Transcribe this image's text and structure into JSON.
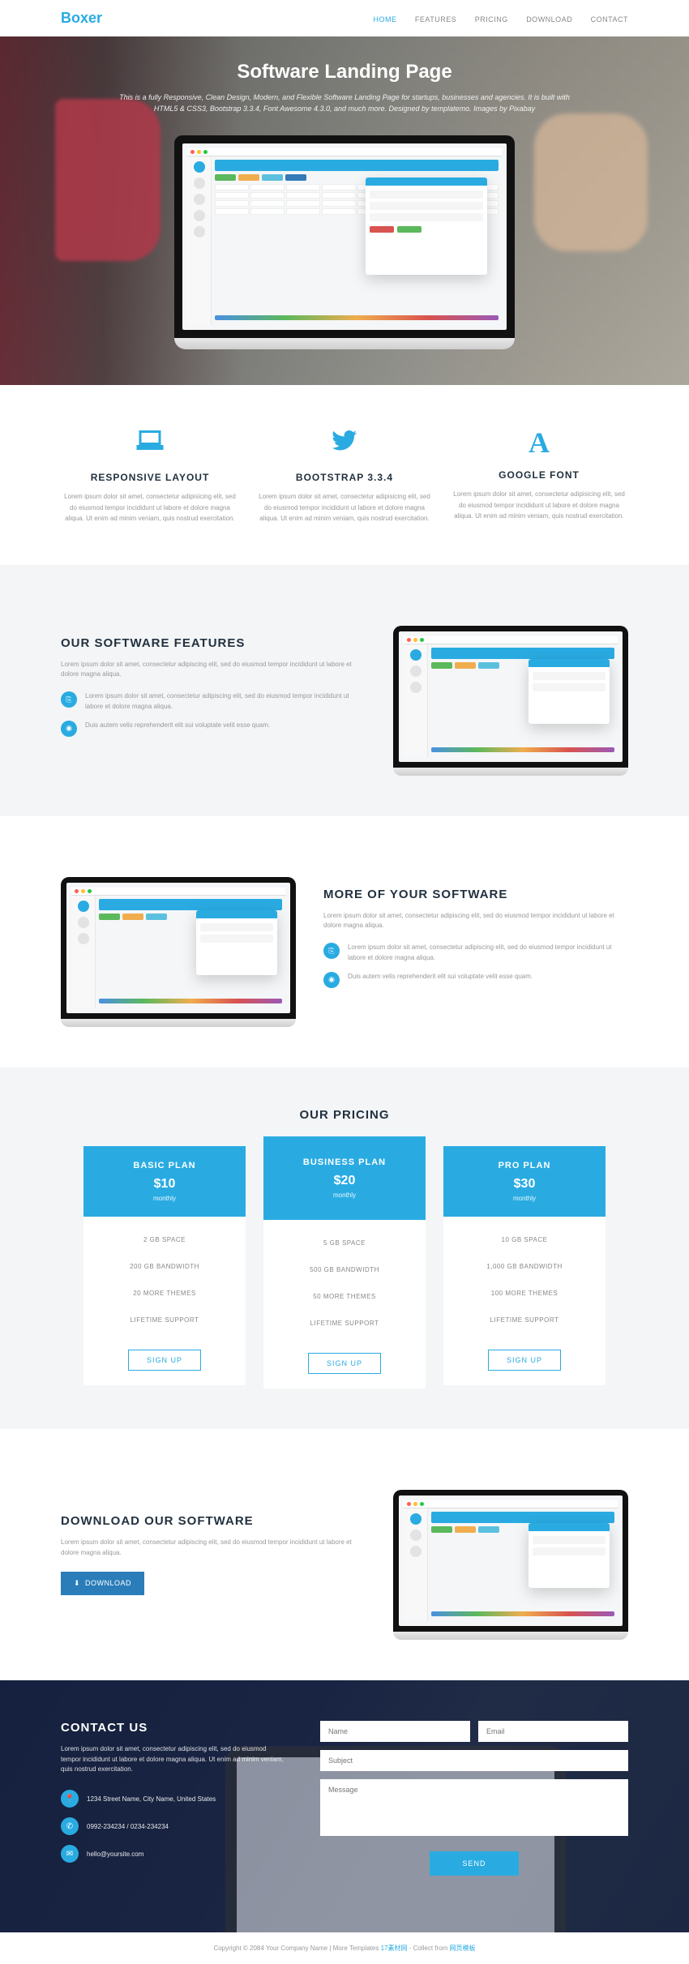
{
  "brand": "Boxer",
  "nav": [
    {
      "label": "HOME",
      "active": true
    },
    {
      "label": "FEATURES",
      "active": false
    },
    {
      "label": "PRICING",
      "active": false
    },
    {
      "label": "DOWNLOAD",
      "active": false
    },
    {
      "label": "CONTACT",
      "active": false
    }
  ],
  "hero": {
    "title": "Software Landing Page",
    "subtitle": "This is a fully Responsive, Clean Design, Modern, and Flexible Software Landing Page for startups, businesses and agencies. It is built with HTML5 & CSS3, Bootstrap 3.3.4, Font Awesome 4.3.0, and much more. Designed by templatemo. Images by Pixabay"
  },
  "benefits": [
    {
      "title": "RESPONSIVE LAYOUT",
      "desc": "Lorem ipsum dolor sit amet, consectetur adipisicing elit, sed do eiusmod tempor incididunt ut labore et dolore magna aliqua. Ut enim ad minim veniam, quis nostrud exercitation."
    },
    {
      "title": "BOOTSTRAP 3.3.4",
      "desc": "Lorem ipsum dolor sit amet, consectetur adipisicing elit, sed do eiusmod tempor incididunt ut labore et dolore magna aliqua. Ut enim ad minim veniam, quis nostrud exercitation."
    },
    {
      "title": "GOOGLE FONT",
      "desc": "Lorem ipsum dolor sit amet, consectetur adipisicing elit, sed do eiusmod tempor incididunt ut labore et dolore magna aliqua. Ut enim ad minim veniam, quis nostrud exercitation."
    }
  ],
  "feature1": {
    "title": "OUR SOFTWARE FEATURES",
    "desc": "Lorem ipsum dolor sit amet, consectetur adipiscing elit, sed do eiusmod tempor incididunt ut labore et dolore magna aliqua.",
    "b1": "Lorem ipsum dolor sit amet, consectetur adipiscing elit, sed do eiusmod tempor incididunt ut labore et dolore magna aliqua.",
    "b2": "Duis autem velis reprehenderit elit sui voluptate velit esse quam."
  },
  "feature2": {
    "title": "MORE OF YOUR SOFTWARE",
    "desc": "Lorem ipsum dolor sit amet, consectetur adipiscing elit, sed do eiusmod tempor incididunt ut labore et dolore magna aliqua.",
    "b1": "Lorem ipsum dolor sit amet, consectetur adipiscing elit, sed do eiusmod tempor incididunt ut labore et dolore magna aliqua.",
    "b2": "Duis autem velis reprehenderit elit sui voluptate velit esse quam."
  },
  "pricing": {
    "title": "OUR PRICING",
    "signup": "SIGN UP",
    "plans": [
      {
        "name": "BASIC PLAN",
        "price": "$10",
        "period": "monthly",
        "features": [
          "2 GB SPACE",
          "200 GB BANDWIDTH",
          "20 MORE THEMES",
          "LIFETIME SUPPORT"
        ]
      },
      {
        "name": "BUSINESS PLAN",
        "price": "$20",
        "period": "monthly",
        "features": [
          "5 GB SPACE",
          "500 GB BANDWIDTH",
          "50 MORE THEMES",
          "LIFETIME SUPPORT"
        ]
      },
      {
        "name": "PRO PLAN",
        "price": "$30",
        "period": "monthly",
        "features": [
          "10 GB SPACE",
          "1,000 GB BANDWIDTH",
          "100 MORE THEMES",
          "LIFETIME SUPPORT"
        ]
      }
    ]
  },
  "download": {
    "title": "DOWNLOAD OUR SOFTWARE",
    "desc": "Lorem ipsum dolor sit amet, consectetur adipiscing elit, sed do eiusmod tempor incididunt ut labore et dolore magna aliqua.",
    "button": "DOWNLOAD"
  },
  "contact": {
    "title": "CONTACT US",
    "desc": "Lorem ipsum dolor sit amet, consectetur adipiscing elit, sed do eiusmod tempor incididunt ut labore et dolore magna aliqua. Ut enim ad minim veniam, quis nostrud exercitation.",
    "address": "1234 Street Name, City Name, United States",
    "phone": "0992-234234 / 0234-234234",
    "email": "hello@yoursite.com",
    "ph_name": "Name",
    "ph_email": "Email",
    "ph_subject": "Subject",
    "ph_message": "Message",
    "send": "SEND"
  },
  "footer": {
    "copy": "Copyright © 2084 Your Company Name | More Templates ",
    "link1": "17素材网",
    "mid": " - Collect from ",
    "link2": "网页模板"
  }
}
